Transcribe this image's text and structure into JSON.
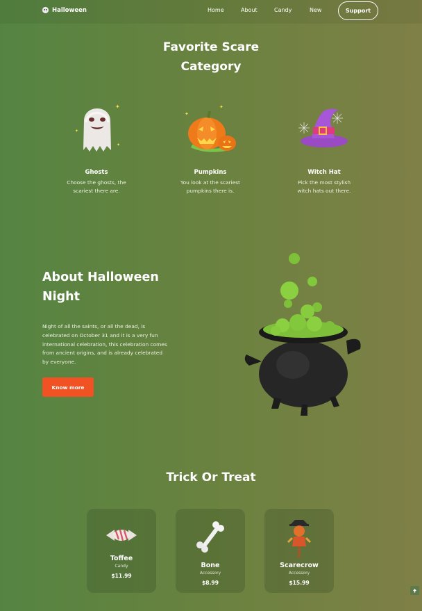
{
  "header": {
    "logo_text": "Halloween",
    "nav": [
      "Home",
      "About",
      "Candy",
      "New"
    ],
    "support_label": "Support"
  },
  "categories": {
    "title_line1": "Favorite Scare",
    "title_line2": "Category",
    "items": [
      {
        "title": "Ghosts",
        "desc_line1": "Choose the ghosts, the",
        "desc_line2": "scariest there are.",
        "icon": "ghost-icon"
      },
      {
        "title": "Pumpkins",
        "desc_line1": "You look at the scariest",
        "desc_line2": "pumpkins there is.",
        "icon": "pumpkin-icon"
      },
      {
        "title": "Witch Hat",
        "desc_line1": "Pick the most stylish",
        "desc_line2": "witch hats out there.",
        "icon": "witch-hat-icon"
      }
    ]
  },
  "about": {
    "title_line1": "About Halloween",
    "title_line2": "Night",
    "text_lines": [
      "Night of all the saints, or all the dead, is",
      "celebrated on October 31 and it is a very fun",
      "international celebration, this celebration comes",
      "from ancient origins, and is already celebrated",
      "by everyone."
    ],
    "button_label": "Know more"
  },
  "treats": {
    "title": "Trick Or Treat",
    "items": [
      {
        "name": "Toffee",
        "category": "Candy",
        "price": "$11.99",
        "icon": "candy-icon"
      },
      {
        "name": "Bone",
        "category": "Accessory",
        "price": "$8.99",
        "icon": "bone-icon"
      },
      {
        "name": "Scarecrow",
        "category": "Accessory",
        "price": "$15.99",
        "icon": "scarecrow-icon"
      }
    ]
  },
  "colors": {
    "accent": "#f05223",
    "bg_left": "#558442",
    "bg_right": "#7f8047"
  }
}
